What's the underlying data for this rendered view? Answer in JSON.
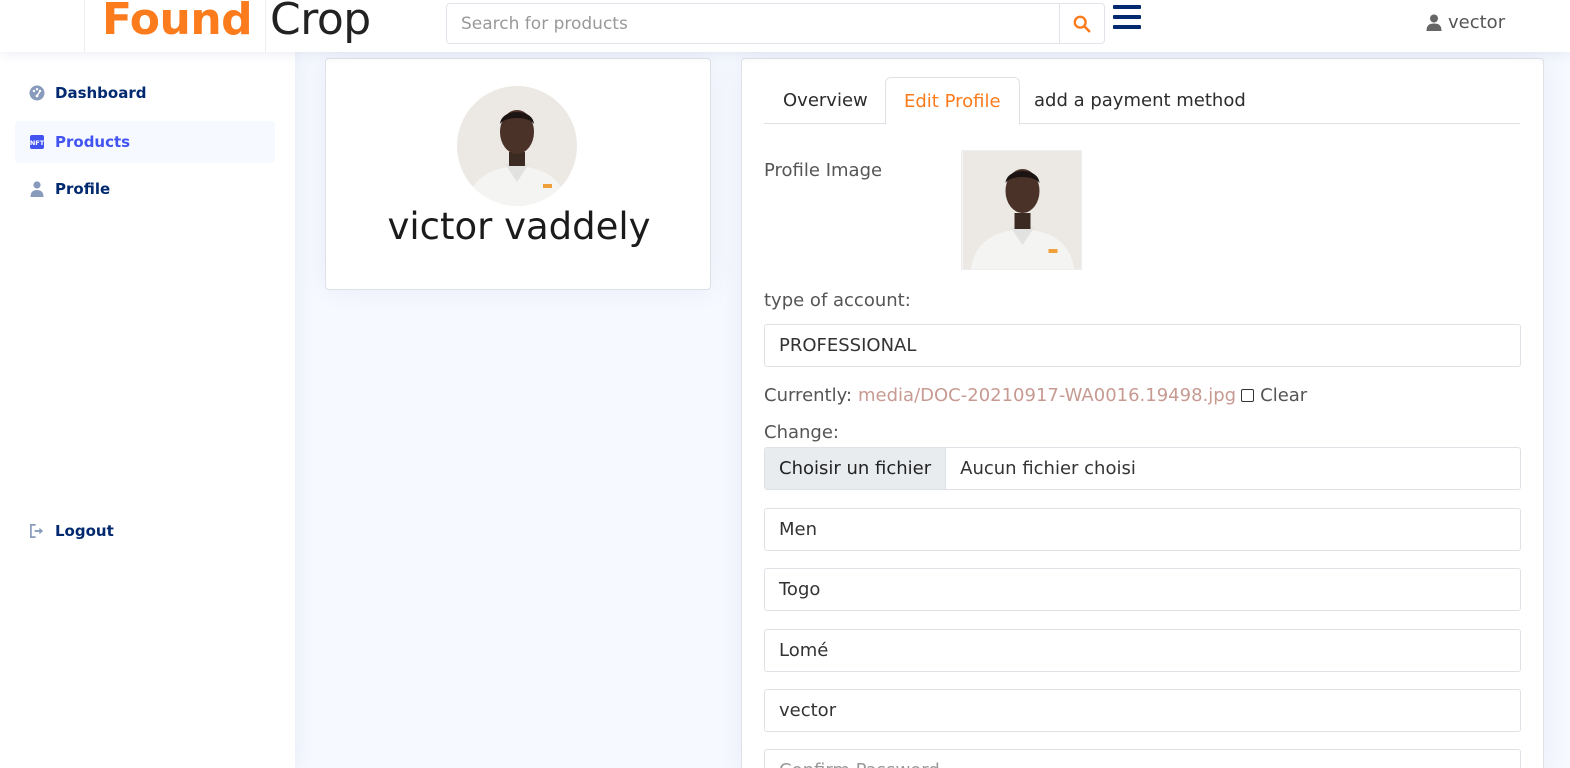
{
  "header": {
    "brand_found": "Found",
    "brand_crop": "Crop",
    "search_placeholder": "Search for products",
    "user_name": "vector"
  },
  "sidebar": {
    "items": [
      {
        "label": "Dashboard",
        "icon": "grid-icon"
      },
      {
        "label": "Products",
        "icon": "nft-icon",
        "active": true
      },
      {
        "label": "Profile",
        "icon": "person-icon"
      }
    ],
    "logout_label": "Logout"
  },
  "profile_card": {
    "name": "victor vaddely"
  },
  "tabs": [
    {
      "label": "Overview"
    },
    {
      "label": "Edit Profile",
      "active": true
    },
    {
      "label": "add a payment method"
    }
  ],
  "form": {
    "profile_image_label": "Profile Image",
    "account_type_label": "type of account:",
    "account_type_value": "PROFESSIONAL",
    "currently_label": "Currently:",
    "current_file": "media/DOC-20210917-WA0016.19498.jpg",
    "clear_label": "Clear",
    "change_label": "Change:",
    "file_button": "Choisir un fichier",
    "file_status": "Aucun fichier choisi",
    "gender_value": "Men",
    "country_value": "Togo",
    "city_value": "Lomé",
    "username_value": "vector",
    "confirm_password_placeholder": "Confirm Password"
  },
  "colors": {
    "brand_orange": "#fc7b1c",
    "nav_blue": "#012970",
    "active_blue": "#4154f1",
    "link_muted": "#c79a92"
  }
}
